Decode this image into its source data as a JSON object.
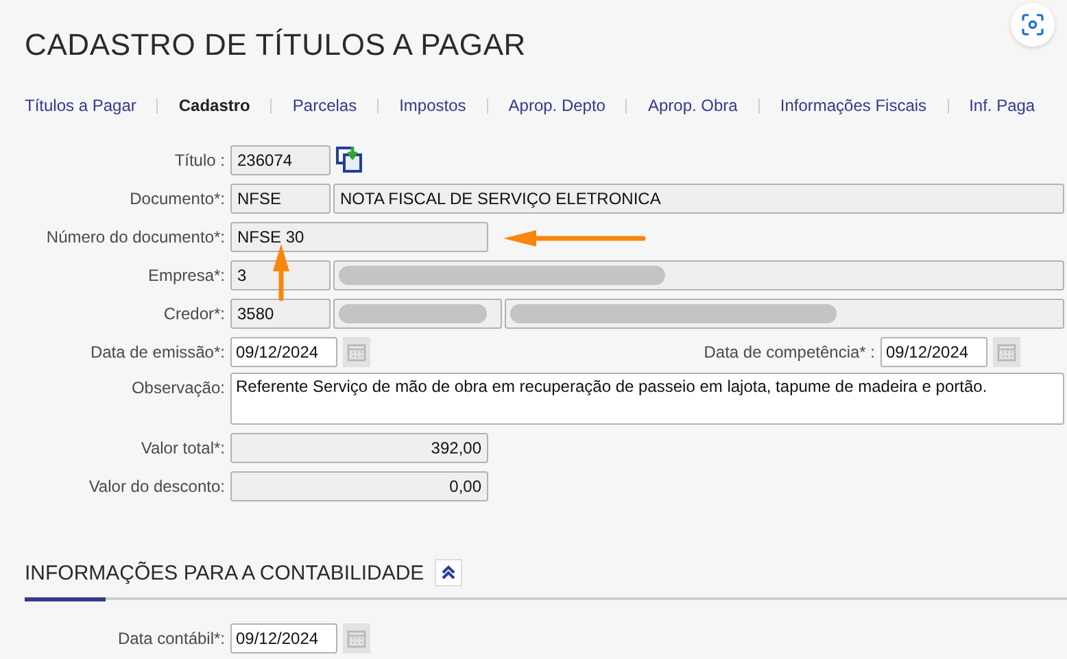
{
  "page": {
    "title": "CADASTRO DE TÍTULOS A PAGAR"
  },
  "tabs": [
    {
      "label": "Títulos a Pagar",
      "selected": false
    },
    {
      "label": "Cadastro",
      "selected": true
    },
    {
      "label": "Parcelas",
      "selected": false
    },
    {
      "label": "Impostos",
      "selected": false
    },
    {
      "label": "Aprop. Depto",
      "selected": false
    },
    {
      "label": "Aprop. Obra",
      "selected": false
    },
    {
      "label": "Informações Fiscais",
      "selected": false
    },
    {
      "label": "Inf. Paga",
      "selected": false
    }
  ],
  "form": {
    "rows": [
      {
        "label": "Título :",
        "fields": [
          {
            "kind": "code",
            "value": "236074",
            "editable": false
          },
          {
            "kind": "copy-button"
          }
        ]
      },
      {
        "label": "Documento*:",
        "fields": [
          {
            "kind": "code",
            "value": "NFSE",
            "editable": false
          },
          {
            "kind": "wide",
            "value": "NOTA FISCAL DE SERVIÇO ELETRONICA",
            "editable": false
          }
        ]
      },
      {
        "label": "Número do documento*:",
        "fields": [
          {
            "kind": "number",
            "value": "NFSE 30",
            "editable": false
          }
        ]
      },
      {
        "label": "Empresa*:",
        "fields": [
          {
            "kind": "code",
            "value": "3",
            "editable": false
          },
          {
            "kind": "masked-wide",
            "editable": false
          }
        ]
      },
      {
        "label": "Credor*:",
        "fields": [
          {
            "kind": "code",
            "value": "3580",
            "editable": false
          },
          {
            "kind": "masked-short",
            "editable": false
          },
          {
            "kind": "masked-wide",
            "editable": false
          }
        ]
      },
      {
        "label": "Data de emissão*:",
        "fields": [
          {
            "kind": "date",
            "value": "09/12/2024",
            "editable": true
          }
        ],
        "right": {
          "label": "Data de competência* :",
          "fields": [
            {
              "kind": "date",
              "value": "09/12/2024",
              "editable": true
            }
          ]
        }
      },
      {
        "label": "Observação:",
        "fields": [
          {
            "kind": "textarea",
            "value": "Referente Serviço de mão de obra em recuperação de passeio em lajota, tapume de madeira e portão.",
            "editable": true
          }
        ]
      },
      {
        "label": "Valor total*:",
        "fields": [
          {
            "kind": "money",
            "value": "392,00",
            "editable": false
          }
        ]
      },
      {
        "label": "Valor do desconto:",
        "fields": [
          {
            "kind": "money",
            "value": "0,00",
            "editable": false
          }
        ]
      }
    ]
  },
  "section": {
    "title": "INFORMAÇÕES PARA A CONTABILIDADE",
    "expanded": true,
    "rows": [
      {
        "label": "Data contábil*:",
        "fields": [
          {
            "kind": "date",
            "value": "09/12/2024",
            "editable": true
          }
        ]
      }
    ]
  },
  "annotations": [
    {
      "kind": "arrow-left"
    },
    {
      "kind": "arrow-up"
    }
  ]
}
